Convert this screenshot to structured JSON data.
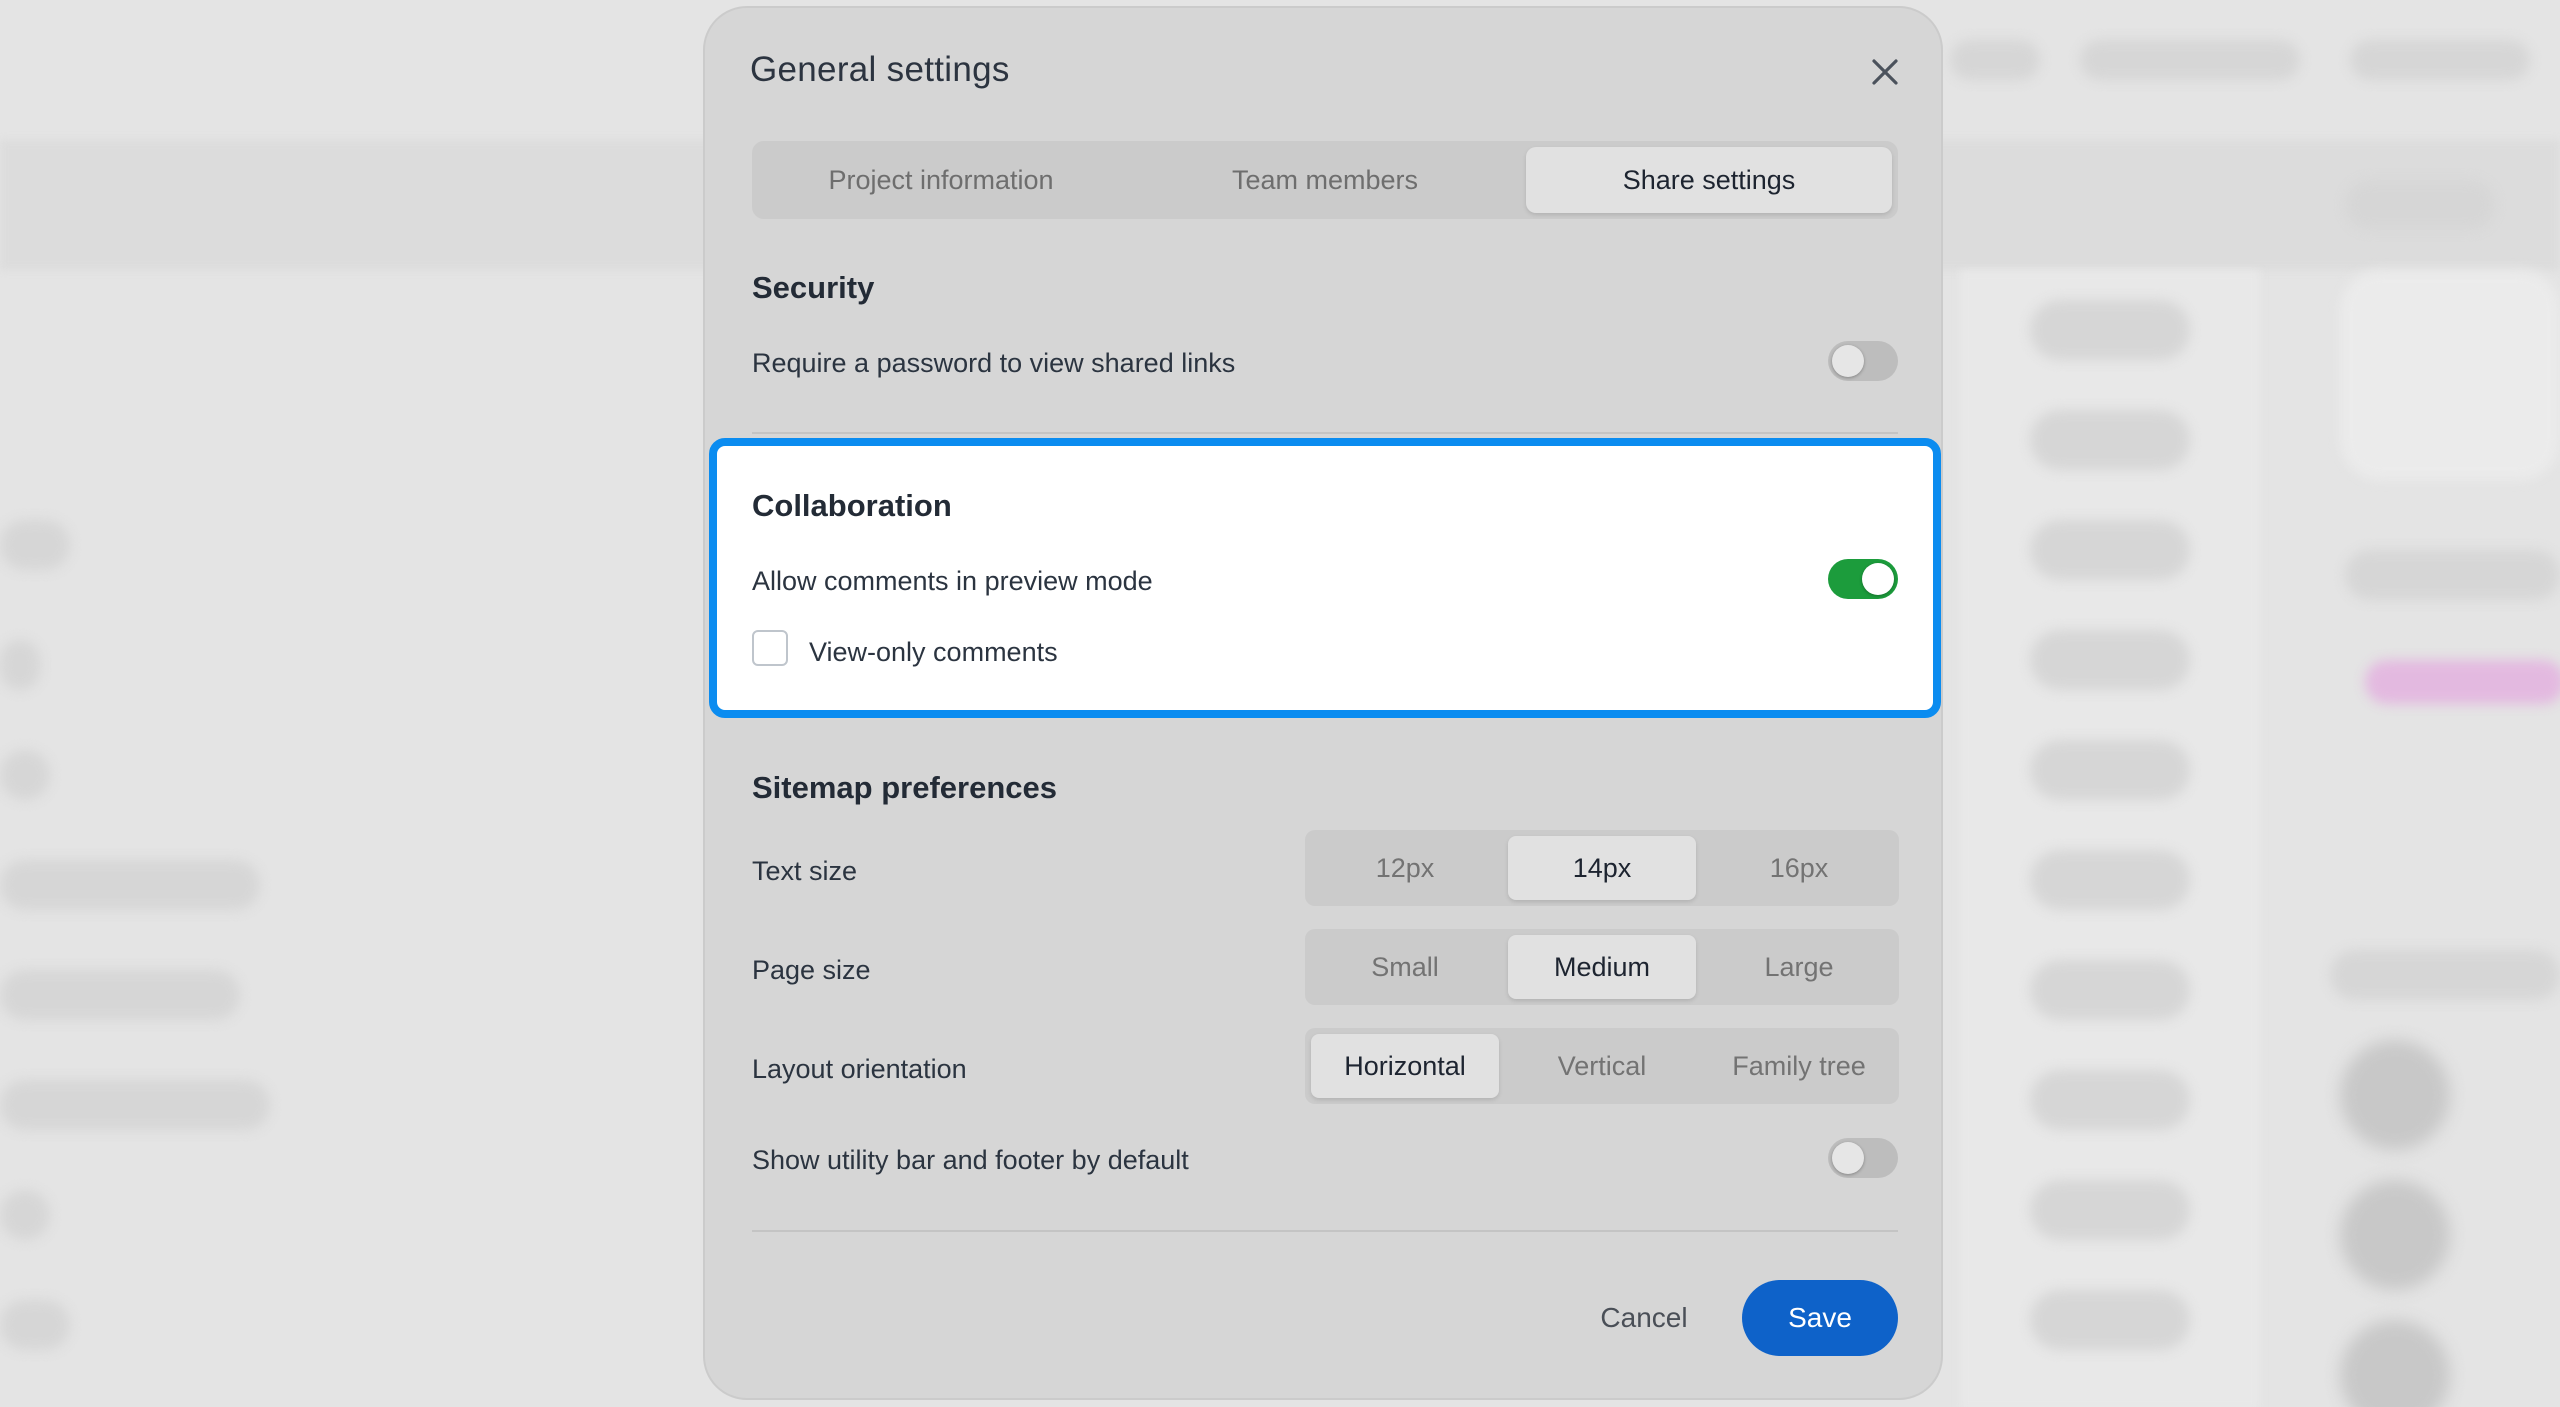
{
  "modal": {
    "title": "General settings",
    "close_icon": "close-icon"
  },
  "tabs": [
    {
      "label": "Project information",
      "active": false
    },
    {
      "label": "Team members",
      "active": false
    },
    {
      "label": "Share settings",
      "active": true
    }
  ],
  "security": {
    "title": "Security",
    "password_label": "Require a password to view shared links",
    "password_enabled": false
  },
  "collaboration": {
    "title": "Collaboration",
    "allow_comments_label": "Allow comments in preview mode",
    "allow_comments_enabled": true,
    "view_only_label": "View-only comments",
    "view_only_checked": false
  },
  "sitemap": {
    "title": "Sitemap preferences",
    "text_size": {
      "label": "Text size",
      "options": [
        "12px",
        "14px",
        "16px"
      ],
      "selected": "14px"
    },
    "page_size": {
      "label": "Page size",
      "options": [
        "Small",
        "Medium",
        "Large"
      ],
      "selected": "Medium"
    },
    "layout_orientation": {
      "label": "Layout orientation",
      "options": [
        "Horizontal",
        "Vertical",
        "Family tree"
      ],
      "selected": "Horizontal"
    },
    "utility_bar_label": "Show utility bar and footer by default",
    "utility_bar_enabled": false
  },
  "footer": {
    "cancel_label": "Cancel",
    "save_label": "Save"
  },
  "colors": {
    "highlight_border": "#0b8cf0",
    "toggle_on": "#1c9c3c",
    "save_button": "#0e62c9"
  }
}
